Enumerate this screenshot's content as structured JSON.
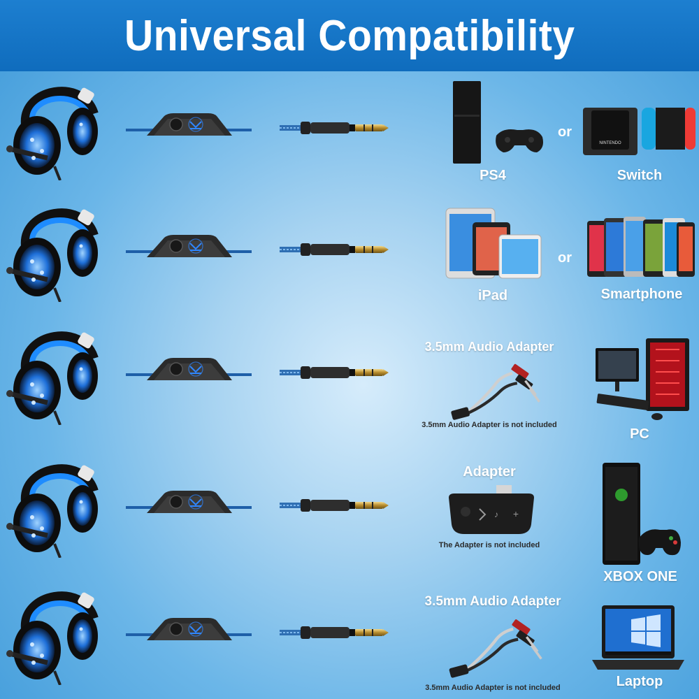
{
  "banner": {
    "title": "Universal Compatibility"
  },
  "rows": [
    {
      "device_a": {
        "label": "PS4",
        "icon": "ps4-console-icon"
      },
      "connector": "or",
      "device_b": {
        "label": "Switch",
        "icon": "nintendo-switch-icon"
      }
    },
    {
      "device_a": {
        "label": "iPad",
        "icon": "ipad-icon"
      },
      "connector": "or",
      "device_b": {
        "label": "Smartphone",
        "icon": "smartphone-icon"
      }
    },
    {
      "adapter": {
        "title": "3.5mm Audio Adapter",
        "note": "3.5mm Audio Adapter is not included",
        "icon": "y-splitter-cable-icon"
      },
      "device_b": {
        "label": "PC",
        "icon": "gaming-pc-icon"
      }
    },
    {
      "adapter": {
        "title": "Adapter",
        "note": "The Adapter is not included",
        "icon": "xbox-headset-adapter-icon"
      },
      "device_b": {
        "label": "XBOX ONE",
        "icon": "xbox-console-icon"
      }
    },
    {
      "adapter": {
        "title": "3.5mm Audio Adapter",
        "note": "3.5mm Audio Adapter is not included",
        "icon": "y-splitter-cable-icon"
      },
      "device_b": {
        "label": "Laptop",
        "icon": "laptop-icon"
      }
    }
  ],
  "colors": {
    "banner": "#0f6cbd",
    "background": "#6bb6e8",
    "headset_glow": "#1e8cff"
  }
}
